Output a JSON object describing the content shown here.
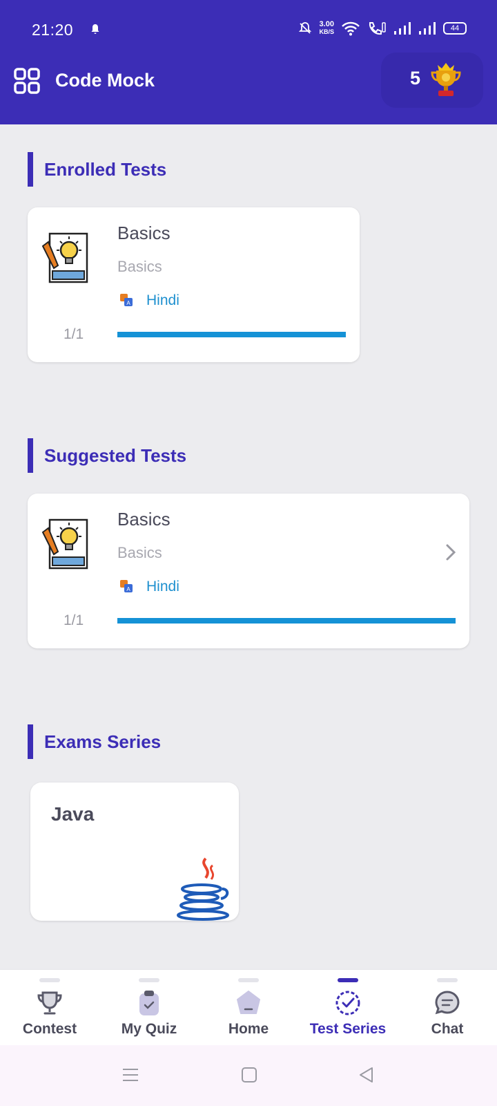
{
  "status_bar": {
    "time": "21:20",
    "speed_value": "3.00",
    "speed_unit": "KB/S",
    "battery": "44"
  },
  "header": {
    "title": "Code Mock",
    "trophy_count": "5"
  },
  "enrolled": {
    "title": "Enrolled Tests",
    "cards": [
      {
        "name": "Basics",
        "subtitle": "Basics",
        "language": "Hindi",
        "progress_label": "1/1",
        "progress": 1.0
      }
    ]
  },
  "suggested": {
    "title": "Suggested Tests",
    "cards": [
      {
        "name": "Basics",
        "subtitle": "Basics",
        "language": "Hindi",
        "progress_label": "1/1",
        "progress": 1.0
      }
    ]
  },
  "exams": {
    "title": "Exams Series",
    "items": [
      {
        "name": "Java",
        "icon": "java-logo-icon"
      }
    ]
  },
  "bottom_nav": {
    "items": [
      {
        "label": "Contest",
        "icon": "trophy-icon",
        "active": false
      },
      {
        "label": "My Quiz",
        "icon": "clipboard-check-icon",
        "active": false
      },
      {
        "label": "Home",
        "icon": "home-pentagon-icon",
        "active": false
      },
      {
        "label": "Test Series",
        "icon": "badge-check-icon",
        "active": true
      },
      {
        "label": "Chat",
        "icon": "chat-bubble-icon",
        "active": false
      }
    ]
  },
  "colors": {
    "primary": "#3C2DB6",
    "progress": "#1592D6",
    "language_text": "#1E90CF",
    "background": "#ECECEF"
  }
}
